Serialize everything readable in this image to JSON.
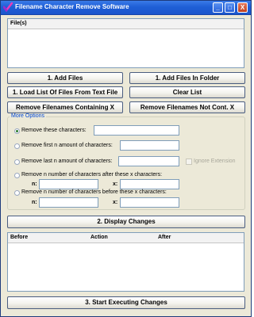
{
  "window": {
    "title": "Filename Character Remove Software",
    "controls": {
      "minimize": "_",
      "maximize": "□",
      "close": "X"
    }
  },
  "files_list": {
    "header": "File(s)"
  },
  "buttons": {
    "add_files": "1. Add Files",
    "add_folder": "1. Add Files In Folder",
    "load_list": "1. Load List Of Files From Text File",
    "clear_list": "Clear List",
    "remove_containing": "Remove Filenames Containing X",
    "remove_not_containing": "Remove Filenames Not Cont. X",
    "display_changes": "2. Display Changes",
    "start_executing": "3. Start Executing Changes"
  },
  "options": {
    "title": "More Options",
    "remove_chars": "Remove these characters:",
    "remove_first": "Remove first n amount of characters:",
    "remove_last": "Remove last n amount of characters:",
    "ignore_extension": "Ignore Extension",
    "remove_after": "Remove n number of characters after these x characters:",
    "remove_before": "Remove n number of characters before these x characters:",
    "n_label": "n:",
    "x_label": "x:"
  },
  "changes_table": {
    "columns": [
      "Before",
      "Action",
      "After"
    ]
  }
}
